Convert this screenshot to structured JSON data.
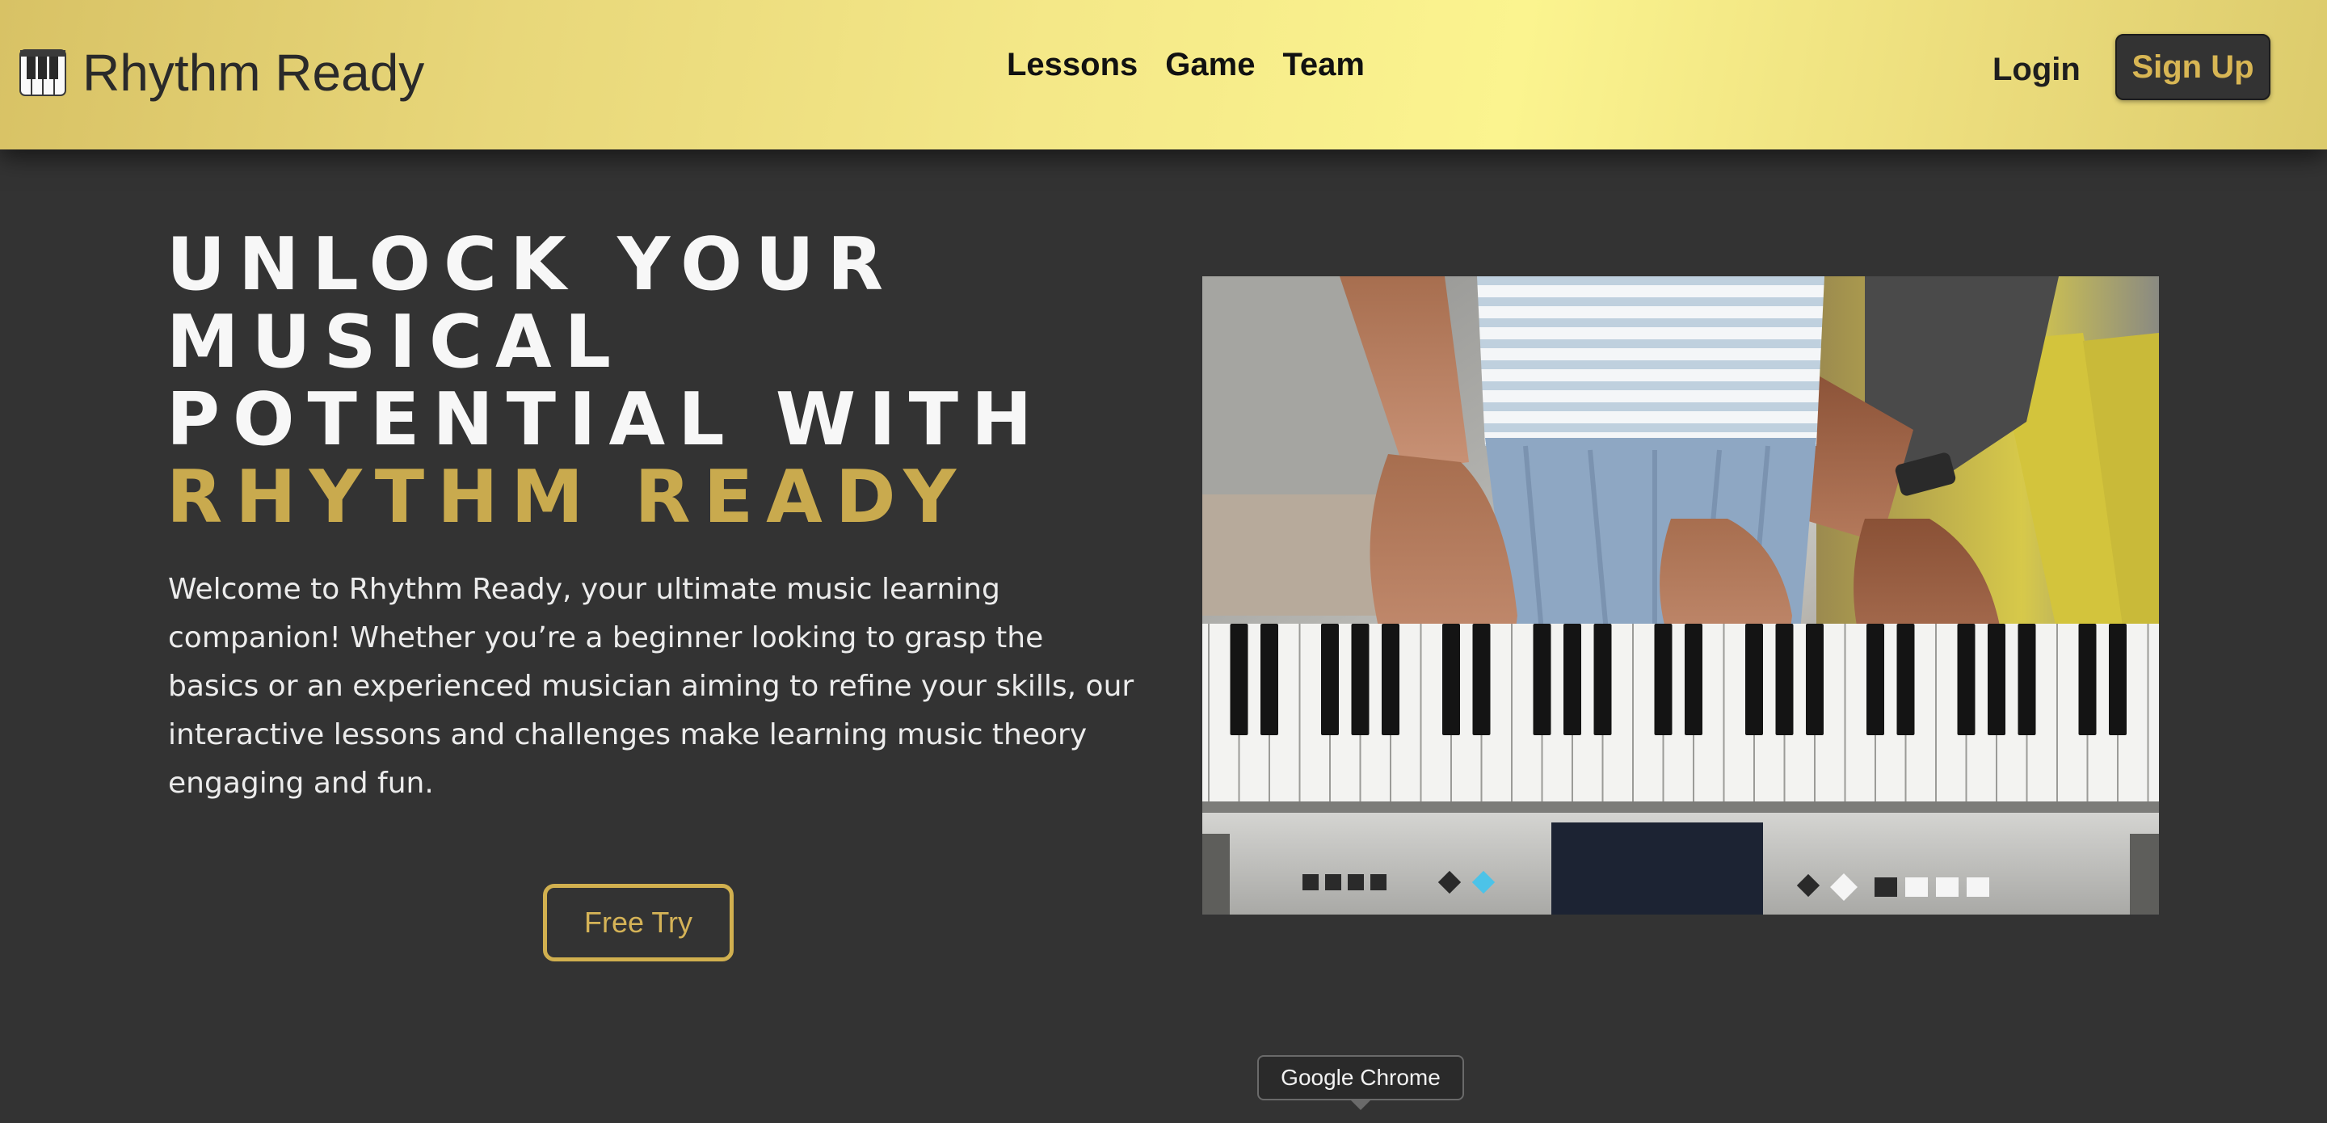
{
  "navbar": {
    "brand": {
      "icon": "piano-keys-icon",
      "name": "Rhythm Ready"
    },
    "links": [
      "Lessons",
      "Game",
      "Team"
    ],
    "login_label": "Login",
    "signup_label": "Sign Up"
  },
  "hero": {
    "title_lines": [
      "UNLOCK YOUR",
      "MUSICAL",
      "POTENTIAL WITH"
    ],
    "title_accent": "RHYTHM READY",
    "description": "Welcome to Rhythm Ready, your ultimate music learning companion! Whether you’re a beginner looking to grasp the basics or an experienced musician aiming to refine your skills, our interactive lessons and challenges make learning music theory engaging and fun.",
    "cta_label": "Free Try",
    "image": "hands-playing-piano-keyboard-photo"
  },
  "tooltip": {
    "text": "Google Chrome"
  },
  "colors": {
    "navbar_gold": "#f4e888",
    "accent_gold": "#c9aa4e",
    "background": "#333333",
    "title_white": "#f7f7f7"
  }
}
